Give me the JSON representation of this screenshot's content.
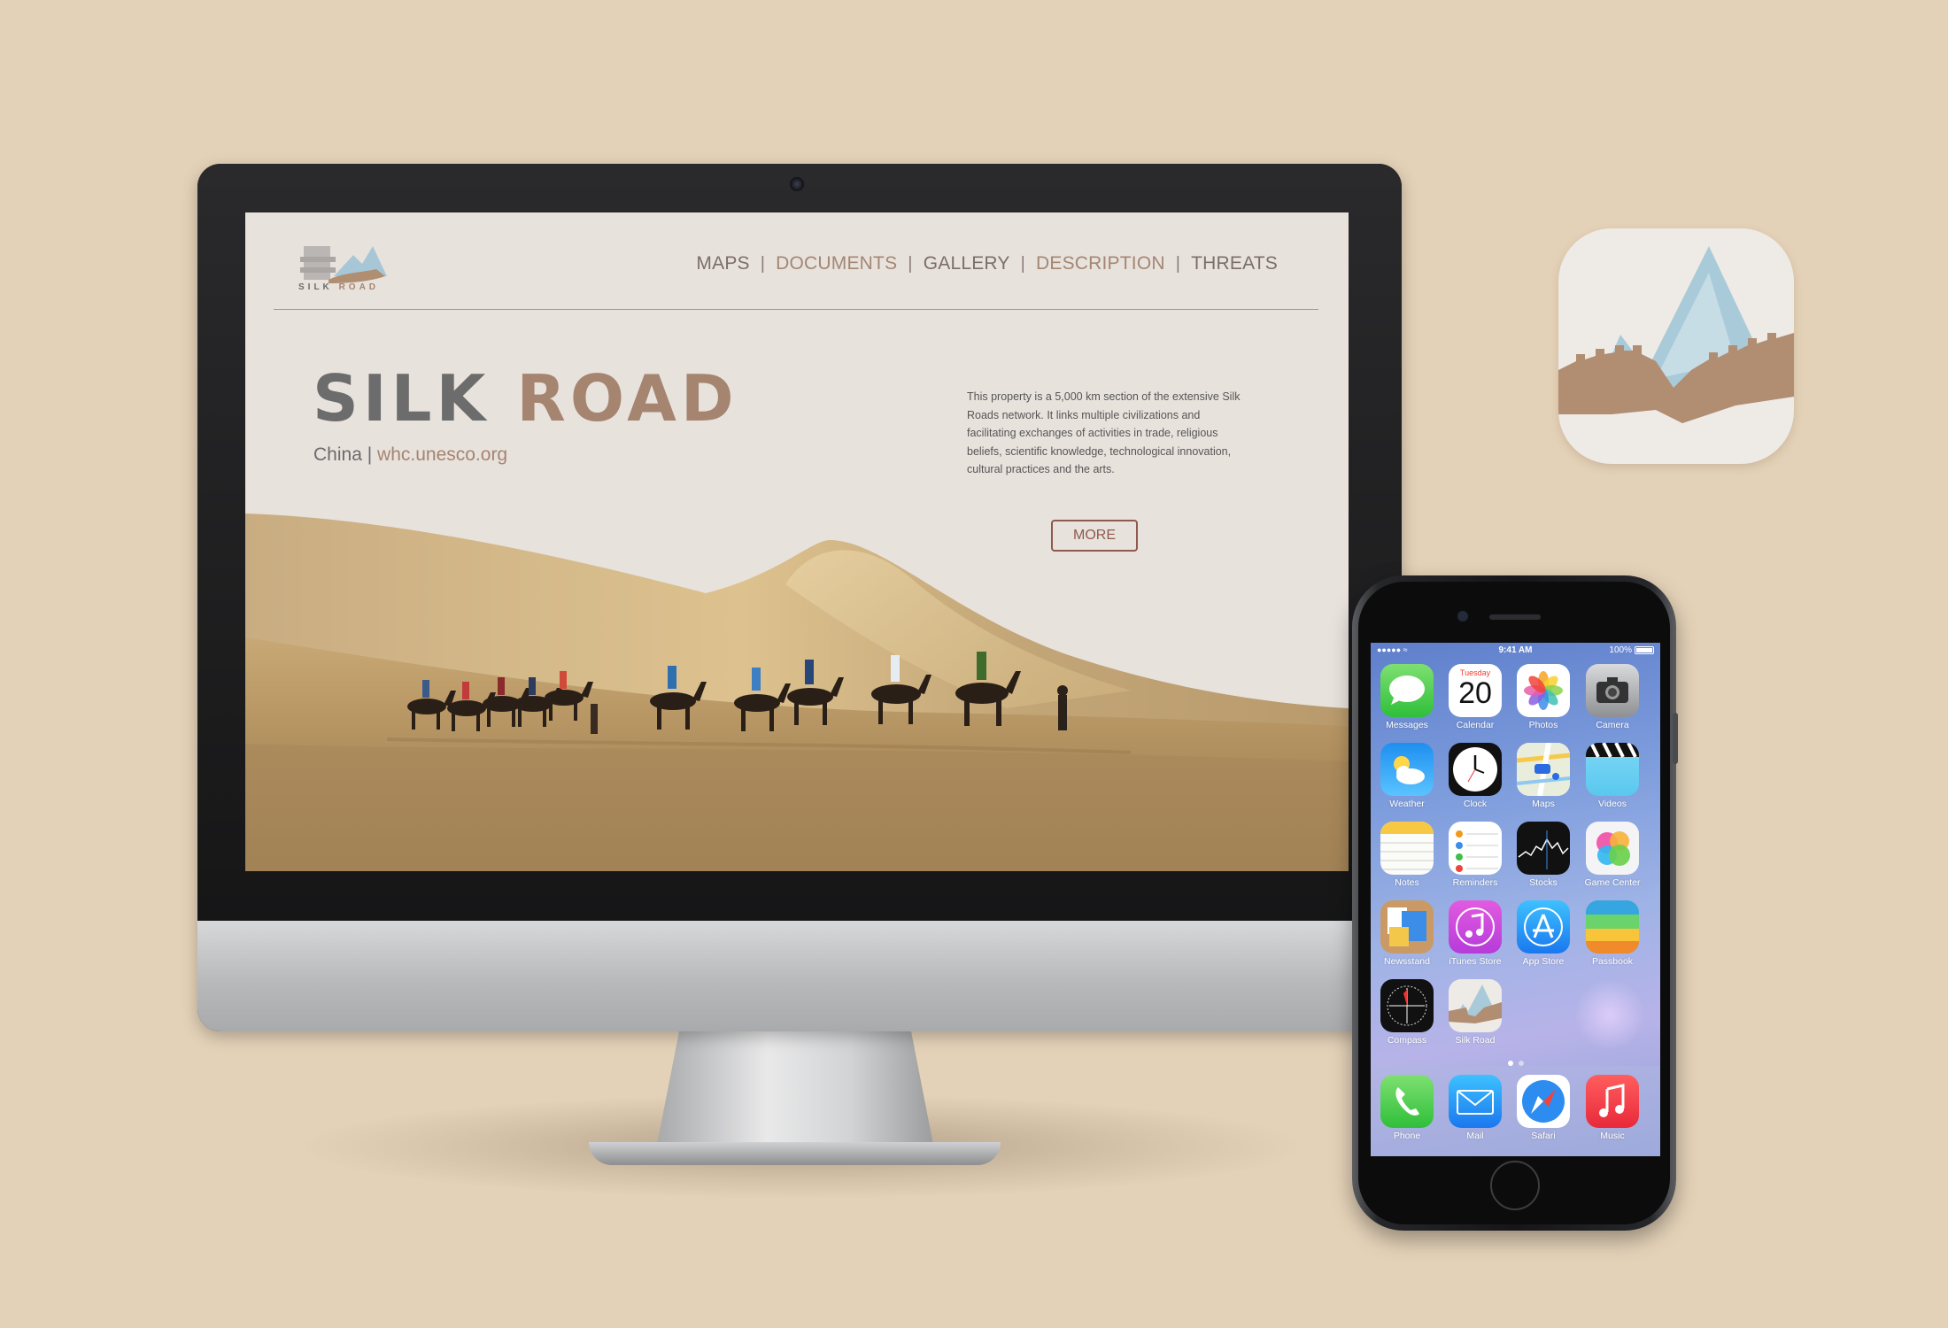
{
  "website": {
    "logo": {
      "word1": "SILK",
      "word2": "ROAD"
    },
    "nav": [
      "MAPS",
      "DOCUMENTS",
      "GALLERY",
      "DESCRIPTION",
      "THREATS"
    ],
    "hero": {
      "title_part1": "SILK",
      "title_part2": "ROAD",
      "country": "China",
      "separator": "|",
      "link": "whc.unesco.org"
    },
    "description": "This property is a 5,000 km section of the extensive Silk Roads network. It links multiple civilizations and facilitating exchanges of activities in trade, religious beliefs, scientific knowledge, technological innovation, cultural practices and the arts.",
    "more_button": "MORE"
  },
  "colors": {
    "background": "#e4d2b8",
    "site_background": "#e8e2dd",
    "accent_brown": "#a58470",
    "text_gray": "#6c6c6c",
    "button_border": "#8e5a4f"
  },
  "phone": {
    "status": {
      "signal": "●●●●● ≈",
      "time": "9:41 AM",
      "battery": "100%"
    },
    "calendar": {
      "day": "Tuesday",
      "date": "20"
    },
    "apps": [
      {
        "label": "Messages",
        "icon": "messages-icon"
      },
      {
        "label": "Calendar",
        "icon": "calendar-icon"
      },
      {
        "label": "Photos",
        "icon": "photos-icon"
      },
      {
        "label": "Camera",
        "icon": "camera-icon"
      },
      {
        "label": "Weather",
        "icon": "weather-icon"
      },
      {
        "label": "Clock",
        "icon": "clock-icon"
      },
      {
        "label": "Maps",
        "icon": "maps-icon"
      },
      {
        "label": "Videos",
        "icon": "videos-icon"
      },
      {
        "label": "Notes",
        "icon": "notes-icon"
      },
      {
        "label": "Reminders",
        "icon": "reminders-icon"
      },
      {
        "label": "Stocks",
        "icon": "stocks-icon"
      },
      {
        "label": "Game Center",
        "icon": "game-center-icon"
      },
      {
        "label": "Newsstand",
        "icon": "newsstand-icon"
      },
      {
        "label": "iTunes Store",
        "icon": "itunes-store-icon"
      },
      {
        "label": "App Store",
        "icon": "app-store-icon"
      },
      {
        "label": "Passbook",
        "icon": "passbook-icon"
      },
      {
        "label": "Compass",
        "icon": "compass-icon"
      },
      {
        "label": "Silk Road",
        "icon": "silk-road-icon"
      }
    ],
    "dock": [
      {
        "label": "Phone",
        "icon": "phone-icon"
      },
      {
        "label": "Mail",
        "icon": "mail-icon"
      },
      {
        "label": "Safari",
        "icon": "safari-icon"
      },
      {
        "label": "Music",
        "icon": "music-icon"
      }
    ],
    "page_dots": {
      "count": 2,
      "active": 1
    }
  }
}
